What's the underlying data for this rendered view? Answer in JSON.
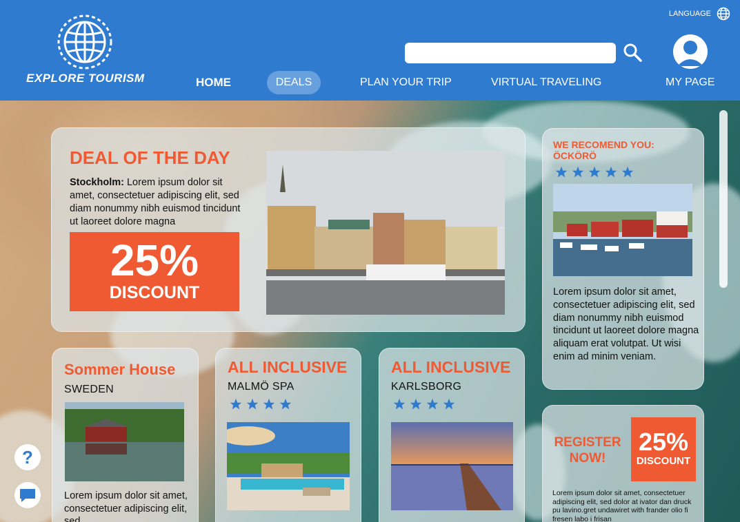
{
  "header": {
    "logo_text": "EXPLORE TOURISM",
    "language_label": "LANGUAGE",
    "search_placeholder": "",
    "nav": {
      "home": "HOME",
      "deals": "DEALS",
      "plan": "PLAN YOUR TRIP",
      "virtual": "VIRTUAL TRAVELING",
      "mypage": "MY PAGE"
    }
  },
  "deal_of_day": {
    "title": "DEAL OF THE DAY",
    "city": "Stockholm:",
    "text": " Lorem ipsum dolor sit amet, consectetuer adipiscing elit, sed diam nonummy nibh euismod tincidunt ut laoreet dolore magna",
    "percent": "25%",
    "discount_word": "DISCOUNT"
  },
  "recommend": {
    "title_line1": "WE RECOMEND YOU:",
    "title_line2": "ÖCKÖRÖ",
    "rating": 5,
    "text": "Lorem ipsum dolor sit amet, consectetuer adipiscing elit, sed diam nonummy nibh euismod tincidunt ut laoreet dolore magna aliquam erat volutpat. Ut wisi enim ad minim veniam."
  },
  "sommer": {
    "title": "Sommer House",
    "subtitle": "SWEDEN",
    "text": "Lorem ipsum dolor sit amet, consectetuer adipiscing elit, sed"
  },
  "inclusive_malmo": {
    "title": "ALL INCLUSIVE",
    "subtitle": "MALMÖ SPA",
    "rating": 4
  },
  "inclusive_karlsborg": {
    "title": "ALL INCLUSIVE",
    "subtitle": "KARLSBORG",
    "rating": 4
  },
  "register": {
    "cta_line1": "REGISTER",
    "cta_line2": "NOW!",
    "percent": "25%",
    "discount_word": "DISCOUNT",
    "text": "Lorem ipsum dolor sit amet, consectetuer adipiscing elit, sed dolor at ivator dan druck pu lavino.gret undawiret with frander olio fi fresen labo i frisan"
  },
  "widgets": {
    "help": "?"
  },
  "colors": {
    "header_blue": "#2f7bd0",
    "accent_orange": "#f05a33",
    "star_blue": "#2f7bd0"
  }
}
